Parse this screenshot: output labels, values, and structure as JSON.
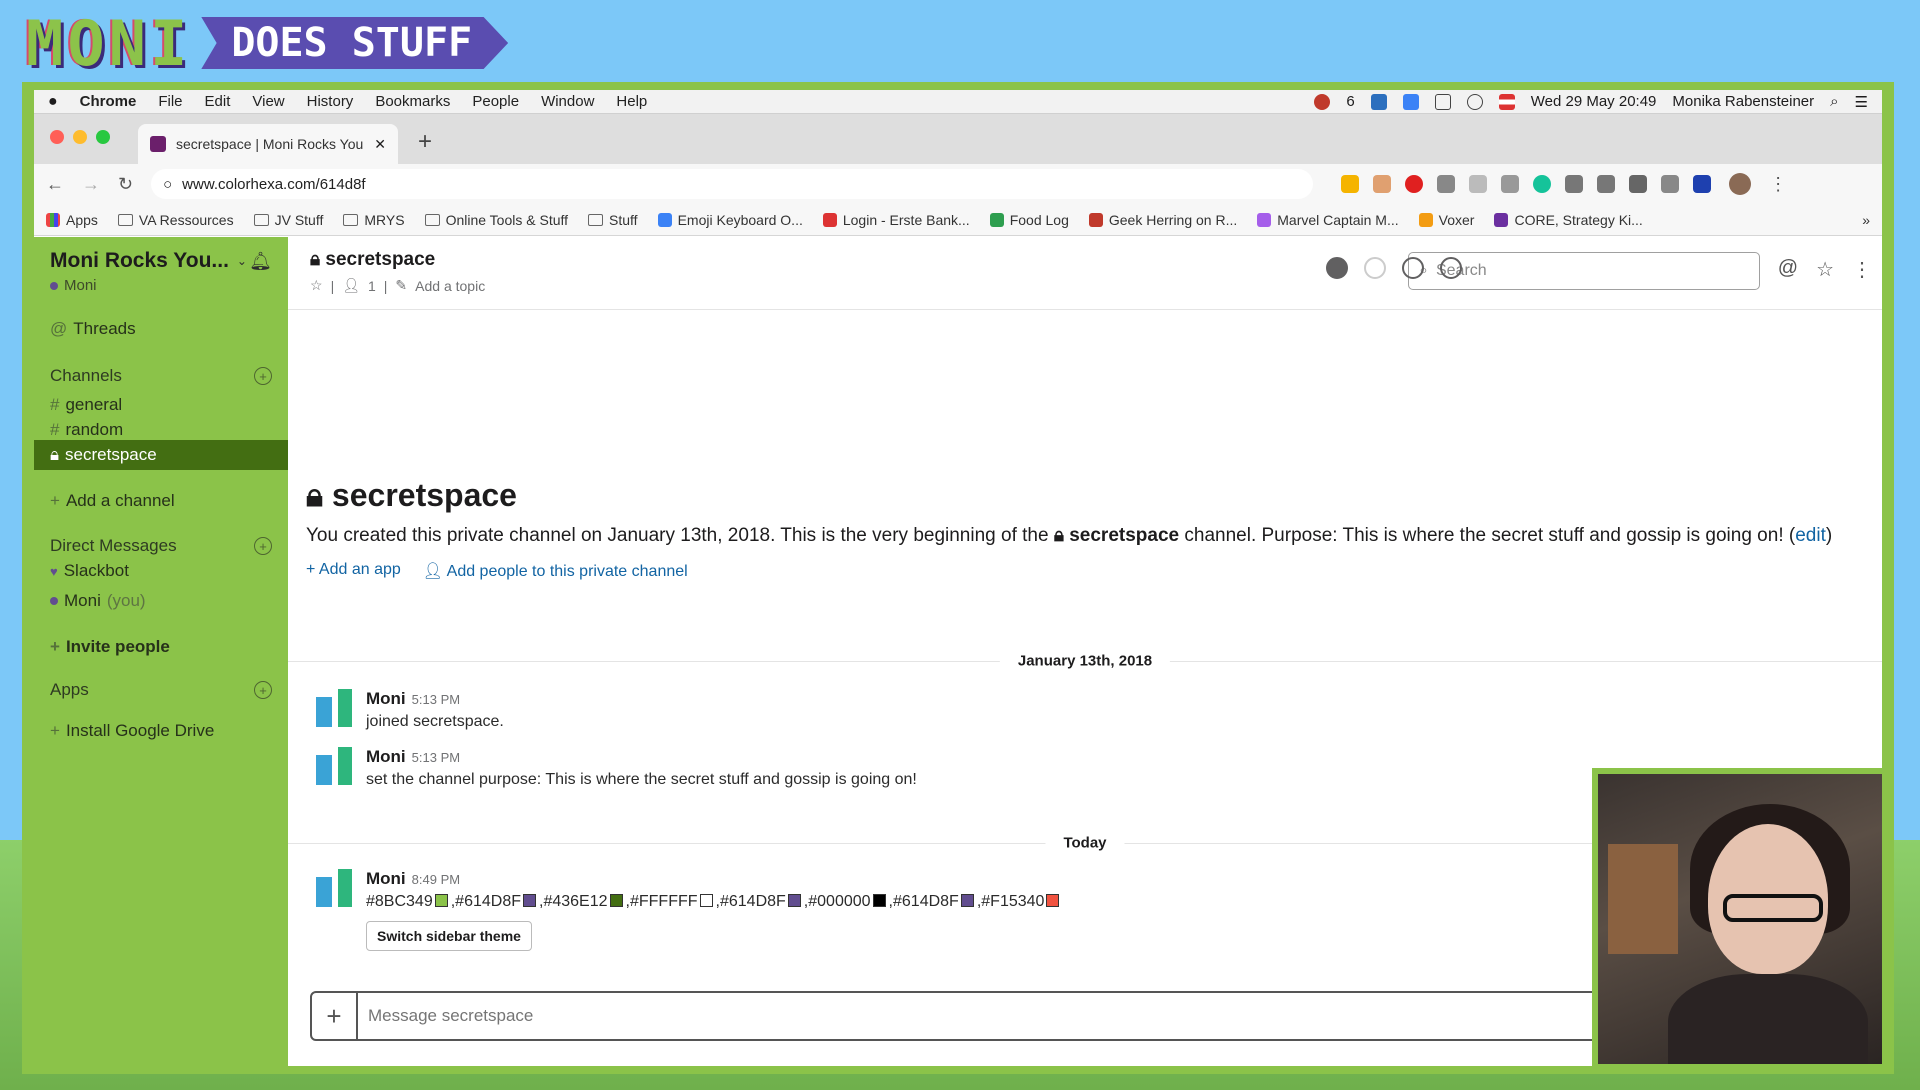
{
  "overlay": {
    "brand_left": "MONI",
    "brand_right": "DOES STUFF"
  },
  "menubar": {
    "apple": "",
    "app": "Chrome",
    "menus": [
      "File",
      "Edit",
      "View",
      "History",
      "Bookmarks",
      "People",
      "Window",
      "Help"
    ],
    "status_count": "6",
    "datetime": "Wed 29 May  20:49",
    "user": "Monika Rabensteiner"
  },
  "browser": {
    "tab_title": "secretspace | Moni Rocks You",
    "url": "www.colorhexa.com/614d8f",
    "bookmarks": [
      "Apps",
      "VA Ressources",
      "JV Stuff",
      "MRYS",
      "Online Tools & Stuff",
      "Stuff",
      "Emoji Keyboard O...",
      "Login - Erste Bank...",
      "Food Log",
      "Geek Herring on R...",
      "Marvel Captain M...",
      "Voxer",
      "CORE, Strategy Ki..."
    ],
    "bookmarks_more": "»"
  },
  "sidebar": {
    "workspace": "Moni Rocks You...",
    "user": "Moni",
    "threads": "Threads",
    "channels_header": "Channels",
    "channels": [
      "general",
      "random",
      "secretspace"
    ],
    "add_channel": "Add a channel",
    "dm_header": "Direct Messages",
    "dm_slackbot": "Slackbot",
    "dm_self": "Moni",
    "dm_self_suffix": "(you)",
    "invite": "Invite people",
    "apps": "Apps",
    "install": "Install Google Drive"
  },
  "channel": {
    "name": "secretspace",
    "member_count": "1",
    "add_topic": "Add a topic",
    "search_placeholder": "Search",
    "intro_title": "secretspace",
    "intro_text_1": "You created this private channel on January 13th, 2018. This is the very beginning of the",
    "intro_channel": "secretspace",
    "intro_text_2": "channel. Purpose: This is where the secret stuff and gossip is going on!",
    "intro_edit": "edit",
    "add_app": "Add an app",
    "add_people": "Add people to this private channel",
    "date_divider": "January 13th, 2018",
    "today_divider": "Today",
    "composer_placeholder": "Message secretspace"
  },
  "messages": [
    {
      "name": "Moni",
      "time": "5:13 PM",
      "text": "joined secretspace."
    },
    {
      "name": "Moni",
      "time": "5:13 PM",
      "text": "set the channel purpose: This is where the secret stuff and gossip is going on!"
    },
    {
      "name": "Moni",
      "time": "8:49 PM",
      "button": "Switch sidebar theme"
    }
  ],
  "swatches": [
    {
      "hex": "#8BC349",
      "color": "#8BC349"
    },
    {
      "hex": "#614D8F",
      "color": "#614D8F"
    },
    {
      "hex": "#436E12",
      "color": "#436E12"
    },
    {
      "hex": "#FFFFFF",
      "color": "#FFFFFF"
    },
    {
      "hex": "#614D8F",
      "color": "#614D8F"
    },
    {
      "hex": "#000000",
      "color": "#000000"
    },
    {
      "hex": "#614D8F",
      "color": "#614D8F"
    },
    {
      "hex": "#F15340",
      "color": "#F15340"
    }
  ]
}
